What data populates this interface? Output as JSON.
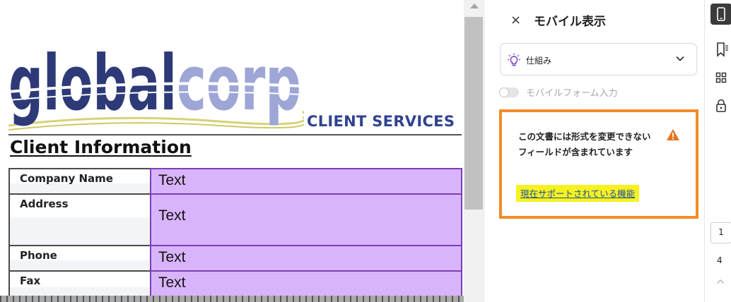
{
  "document": {
    "logo_text": {
      "dark": "global",
      "light": "corp"
    },
    "client_services": "CLIENT SERVICES",
    "section_title": "Client Information",
    "rows": [
      {
        "label": "Company Name",
        "value": "Text"
      },
      {
        "label": "Address",
        "value": "Text"
      },
      {
        "label": "Phone",
        "value": "Text"
      },
      {
        "label": "Fax",
        "value": "Text"
      }
    ],
    "colors": {
      "field_fill": "#dab4fb",
      "field_border": "#7a3fb8",
      "logo_dark": "#2e3a78",
      "logo_light": "#9ea6d6",
      "services": "#2f4390"
    }
  },
  "panel": {
    "close_glyph": "×",
    "title": "モバイル表示",
    "howto": {
      "icon": "lightbulb-icon",
      "label": "仕組み"
    },
    "toggle": {
      "label": "モバイルフォーム入力",
      "enabled": false
    },
    "notice": {
      "text": "この文書には形式を変更できないフィールドが含まれています",
      "icon": "warning-icon",
      "link": "現在サポートされている機能",
      "border_color": "#f28c28",
      "highlight_color": "#f7f21f"
    }
  },
  "rail": {
    "icons": [
      "mobile-view-icon",
      "bookmark-icon",
      "grid-icon",
      "lock-icon"
    ],
    "current_page": "1",
    "total_pages": "4"
  }
}
